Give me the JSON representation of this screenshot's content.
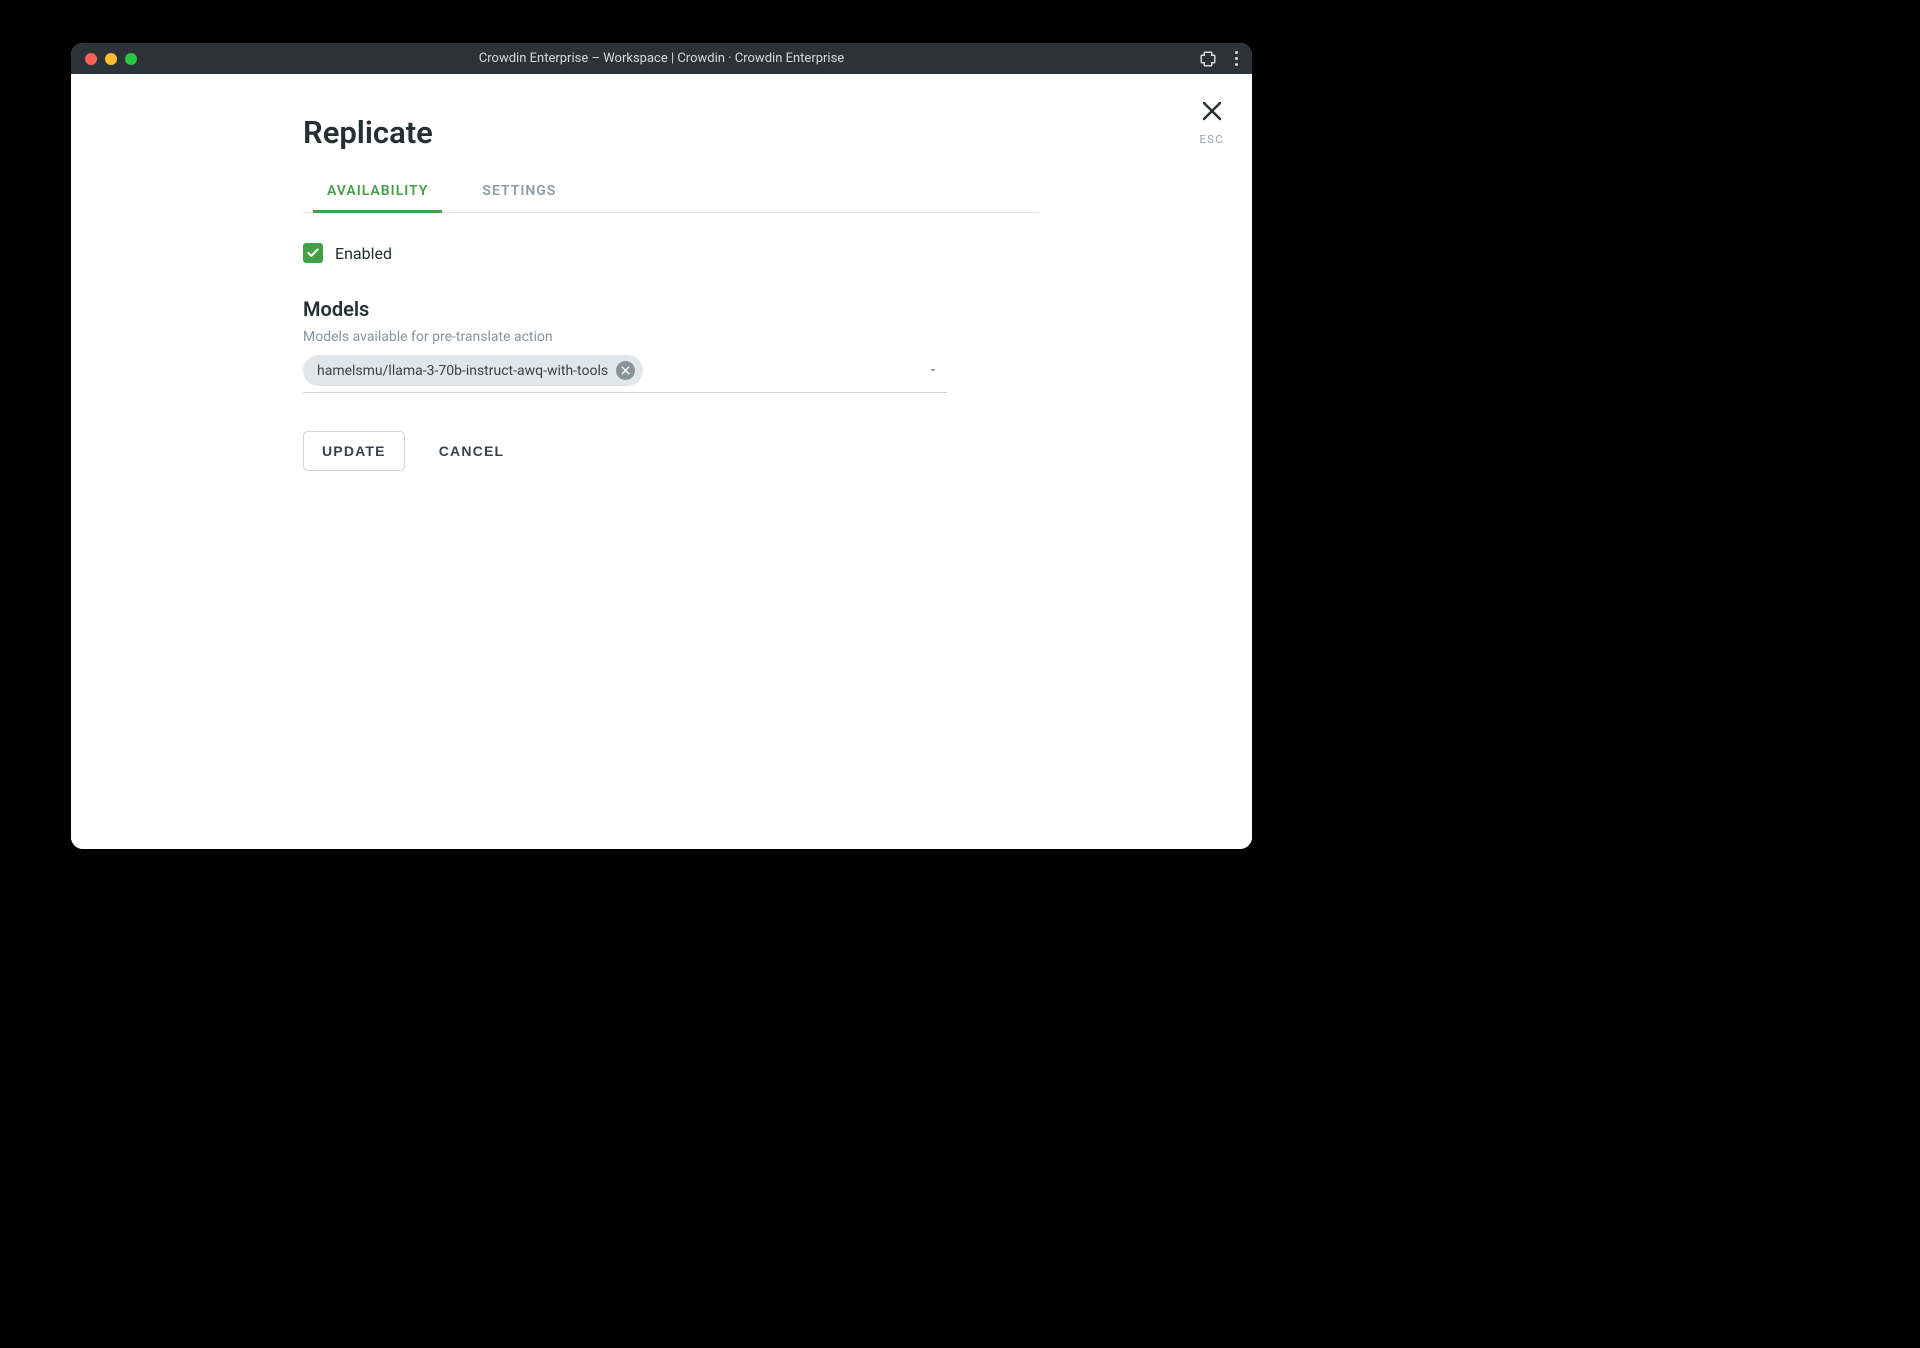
{
  "window": {
    "title": "Crowdin Enterprise – Workspace | Crowdin · Crowdin Enterprise"
  },
  "close": {
    "esc_label": "ESC"
  },
  "panel": {
    "title": "Replicate"
  },
  "tabs": {
    "availability": "AVAILABILITY",
    "settings": "SETTINGS"
  },
  "enabled": {
    "label": "Enabled",
    "checked": true
  },
  "models": {
    "heading": "Models",
    "sub": "Models available for pre-translate action",
    "selected": "hamelsmu/llama-3-70b-instruct-awq-with-tools"
  },
  "actions": {
    "update": "UPDATE",
    "cancel": "CANCEL"
  }
}
